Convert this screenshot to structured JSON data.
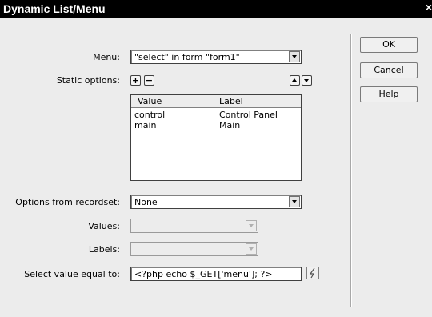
{
  "window": {
    "title": "Dynamic List/Menu",
    "close_glyph": "×"
  },
  "form": {
    "menu_label": "Menu:",
    "menu_value": "\"select\" in form \"form1\"",
    "static_options_label": "Static options:",
    "add_glyph": "+",
    "remove_glyph": "−",
    "options_table": {
      "columns": [
        "Value",
        "Label"
      ],
      "rows": [
        [
          "control",
          "Control Panel"
        ],
        [
          "main",
          "Main"
        ]
      ]
    },
    "recordset_label": "Options from recordset:",
    "recordset_value": "None",
    "values_label": "Values:",
    "values_value": "",
    "labels_label": "Labels:",
    "labels_value": "",
    "select_equal_label": "Select value equal to:",
    "select_equal_value": "<?php echo $_GET['menu']; ?>"
  },
  "buttons": {
    "ok": "OK",
    "cancel": "Cancel",
    "help": "Help"
  },
  "icons": {
    "add": "plus-icon",
    "remove": "minus-icon",
    "up": "arrow-up-icon",
    "down": "arrow-down-icon",
    "dynamic": "lightning-bolt-icon"
  }
}
